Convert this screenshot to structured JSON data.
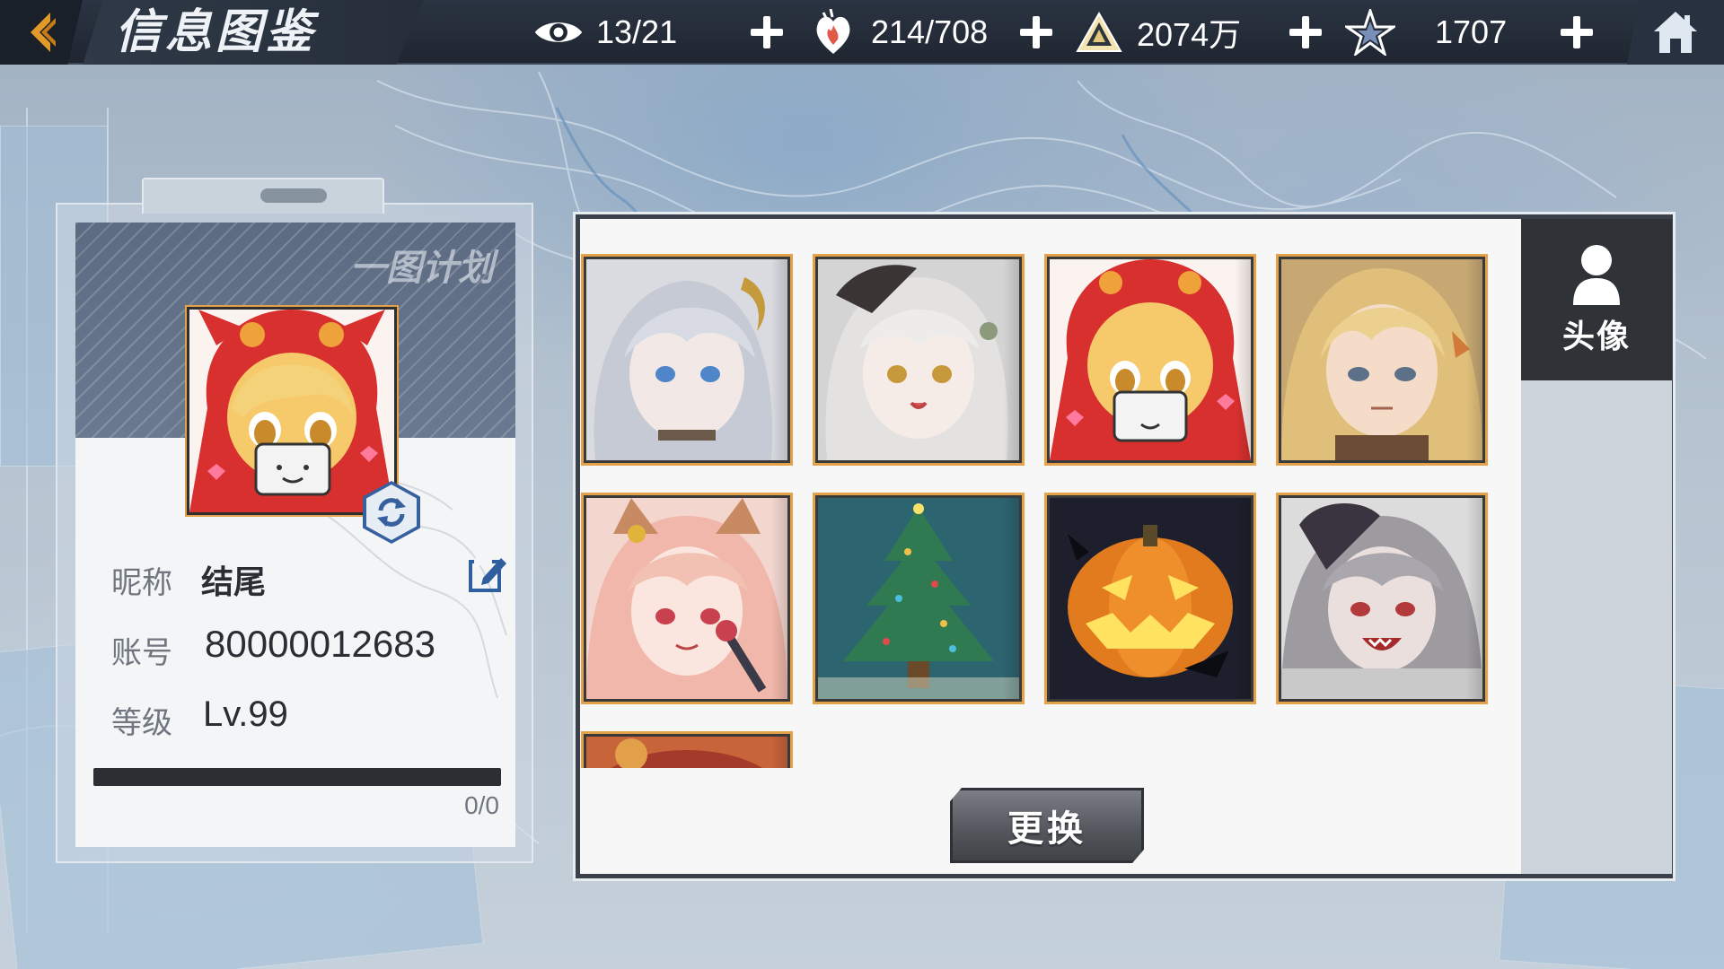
{
  "header": {
    "title": "信息图鉴",
    "resources": [
      {
        "icon": "eye-icon",
        "value": "13/21"
      },
      {
        "icon": "heart-flame-icon",
        "value": "214/708"
      },
      {
        "icon": "pyramid-icon",
        "value": "2074万"
      },
      {
        "icon": "star-badge-icon",
        "value": "1707"
      }
    ]
  },
  "card": {
    "logo": "一图计划",
    "nickname_label": "昵称",
    "nickname": "结尾",
    "account_label": "账号",
    "account": "80000012683",
    "level_label": "等级",
    "level": "Lv.99",
    "progress_text": "0/0",
    "progress_fraction": 0
  },
  "avatar_panel": {
    "tab_label": "头像",
    "confirm_label": "更换",
    "avatars": [
      {
        "name": "silver-hair-horned-girl"
      },
      {
        "name": "white-hair-girl"
      },
      {
        "name": "red-hood-chibi-girl"
      },
      {
        "name": "blonde-pointed-ear-girl"
      },
      {
        "name": "pink-hair-fox-girl"
      },
      {
        "name": "christmas-tree"
      },
      {
        "name": "halloween-pumpkin"
      },
      {
        "name": "grey-hair-grinning-girl"
      },
      {
        "name": "partial-avatar"
      }
    ]
  },
  "colors": {
    "accent": "#e3a24a",
    "topbar": "#1f2631",
    "swap": "#36609e"
  }
}
